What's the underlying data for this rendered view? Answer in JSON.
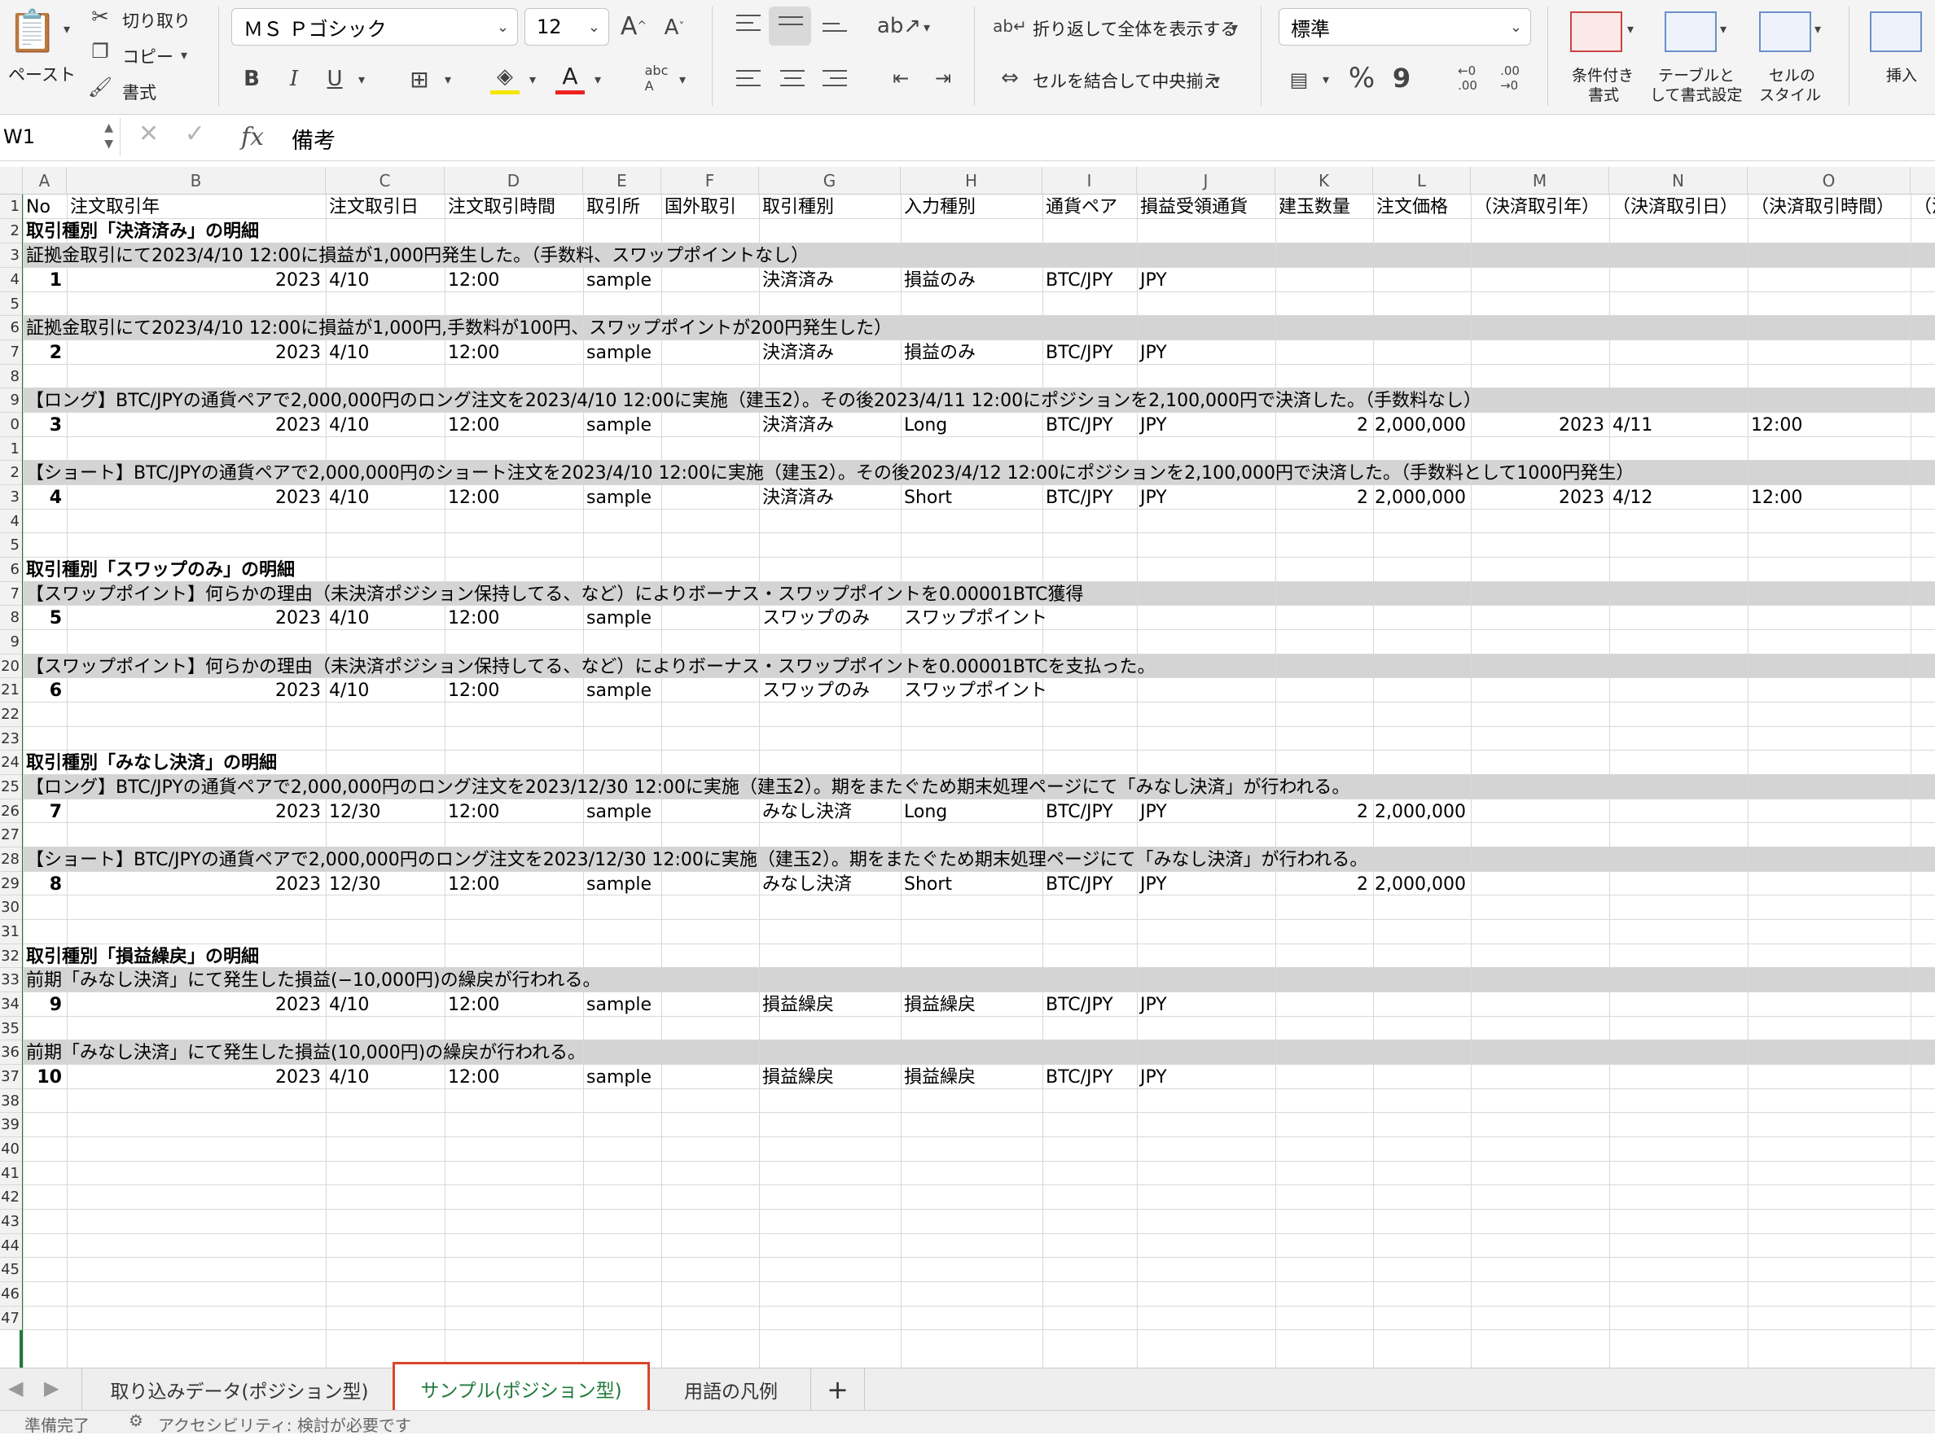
{
  "ribbon": {
    "paste_label": "ペースト",
    "cut_label": "切り取り",
    "copy_label": "コピー",
    "format_painter_label": "書式",
    "font_name": "ＭＳ Ｐゴシック",
    "font_size": "12",
    "bold": "B",
    "italic": "I",
    "underline": "U",
    "wrap_text_label": "折り返して全体を表示する",
    "merge_center_label": "セルを結合して中央揃え",
    "number_format": "標準",
    "percent": "%",
    "comma": "9",
    "conditional_format_label_1": "条件付き",
    "conditional_format_label_2": "書式",
    "table_format_label_1": "テーブルと",
    "table_format_label_2": "して書式設定",
    "cell_style_label_1": "セルの",
    "cell_style_label_2": "スタイル",
    "insert_label": "挿入"
  },
  "formula_bar": {
    "name_box": "W1",
    "fx": "fx",
    "content": "備考"
  },
  "columns": [
    "A",
    "B",
    "C",
    "D",
    "E",
    "F",
    "G",
    "H",
    "I",
    "J",
    "K",
    "L",
    "M",
    "N",
    "O"
  ],
  "header_row": [
    "No",
    "注文取引年",
    "注文取引日",
    "注文取引時間",
    "取引所",
    "国外取引",
    "取引種別",
    "入力種別",
    "通貨ペア",
    "損益受領通貨",
    "建玉数量",
    "注文価格",
    "（決済取引年）",
    "（決済取引日）",
    "（決済取引時間）",
    "（決"
  ],
  "row_numbers": [
    "1",
    "2",
    "3",
    "4",
    "5",
    "6",
    "7",
    "8",
    "9",
    "0",
    "1",
    "2",
    "3",
    "4",
    "5",
    "6",
    "7",
    "8",
    "9",
    "20",
    "21",
    "22",
    "23",
    "24",
    "25",
    "26",
    "27",
    "28",
    "29",
    "30",
    "31",
    "32",
    "33",
    "34",
    "35",
    "36",
    "37",
    "38",
    "39",
    "40",
    "41",
    "42",
    "43",
    "44",
    "45",
    "46",
    "47"
  ],
  "sections": {
    "r2": "取引種別「決済済み」の明細",
    "r3": "証拠金取引にて2023/4/10 12:00に損益が1,000円発生した。（手数料、スワップポイントなし）",
    "r6": "証拠金取引にて2023/4/10 12:00に損益が1,000円,手数料が100円、スワップポイントが200円発生した）",
    "r9": "【ロング】BTC/JPYの通貨ペアで2,000,000円のロング注文を2023/4/10 12:00に実施（建玉2）。その後2023/4/11 12:00にポジションを2,100,000円で決済した。（手数料なし）",
    "r12": "【ショート】BTC/JPYの通貨ペアで2,000,000円のショート注文を2023/4/10 12:00に実施（建玉2）。その後2023/4/12 12:00にポジションを2,100,000円で決済した。（手数料として1000円発生）",
    "r16": "取引種別「スワップのみ」の明細",
    "r17": "【スワップポイント】何らかの理由（未決済ポジション保持してる、など）によりボーナス・スワップポイントを0.00001BTC獲得",
    "r20": "【スワップポイント】何らかの理由（未決済ポジション保持してる、など）によりボーナス・スワップポイントを0.00001BTCを支払った。",
    "r24": "取引種別「みなし決済」の明細",
    "r25": "【ロング】BTC/JPYの通貨ペアで2,000,000円のロング注文を2023/12/30 12:00に実施（建玉2）。期をまたぐため期末処理ページにて「みなし決済」が行われる。",
    "r28": "【ショート】BTC/JPYの通貨ペアで2,000,000円のロング注文を2023/12/30 12:00に実施（建玉2）。期をまたぐため期末処理ページにて「みなし決済」が行われる。",
    "r32": "取引種別「損益繰戻」の明細",
    "r33": "前期「みなし決済」にて発生した損益(−10,000円)の繰戻が行われる。",
    "r36": "前期「みなし決済」にて発生した損益(10,000円)の繰戻が行われる。"
  },
  "records": [
    {
      "no": "1",
      "year": "2023",
      "date": "4/10",
      "time": "12:00",
      "exchange": "sample",
      "type": "決済済み",
      "input": "損益のみ",
      "pair": "BTC/JPY",
      "ccy": "JPY",
      "qty": "",
      "price": "",
      "s_year": "",
      "s_date": "",
      "s_time": ""
    },
    {
      "no": "2",
      "year": "2023",
      "date": "4/10",
      "time": "12:00",
      "exchange": "sample",
      "type": "決済済み",
      "input": "損益のみ",
      "pair": "BTC/JPY",
      "ccy": "JPY",
      "qty": "",
      "price": "",
      "s_year": "",
      "s_date": "",
      "s_time": ""
    },
    {
      "no": "3",
      "year": "2023",
      "date": "4/10",
      "time": "12:00",
      "exchange": "sample",
      "type": "決済済み",
      "input": "Long",
      "pair": "BTC/JPY",
      "ccy": "JPY",
      "qty": "2",
      "price": "2,000,000",
      "s_year": "2023",
      "s_date": "4/11",
      "s_time": "12:00"
    },
    {
      "no": "4",
      "year": "2023",
      "date": "4/10",
      "time": "12:00",
      "exchange": "sample",
      "type": "決済済み",
      "input": "Short",
      "pair": "BTC/JPY",
      "ccy": "JPY",
      "qty": "2",
      "price": "2,000,000",
      "s_year": "2023",
      "s_date": "4/12",
      "s_time": "12:00"
    },
    {
      "no": "5",
      "year": "2023",
      "date": "4/10",
      "time": "12:00",
      "exchange": "sample",
      "type": "スワップのみ",
      "input": "スワップポイント",
      "pair": "",
      "ccy": "",
      "qty": "",
      "price": "",
      "s_year": "",
      "s_date": "",
      "s_time": ""
    },
    {
      "no": "6",
      "year": "2023",
      "date": "4/10",
      "time": "12:00",
      "exchange": "sample",
      "type": "スワップのみ",
      "input": "スワップポイント",
      "pair": "",
      "ccy": "",
      "qty": "",
      "price": "",
      "s_year": "",
      "s_date": "",
      "s_time": ""
    },
    {
      "no": "7",
      "year": "2023",
      "date": "12/30",
      "time": "12:00",
      "exchange": "sample",
      "type": "みなし決済",
      "input": "Long",
      "pair": "BTC/JPY",
      "ccy": "JPY",
      "qty": "2",
      "price": "2,000,000",
      "s_year": "",
      "s_date": "",
      "s_time": ""
    },
    {
      "no": "8",
      "year": "2023",
      "date": "12/30",
      "time": "12:00",
      "exchange": "sample",
      "type": "みなし決済",
      "input": "Short",
      "pair": "BTC/JPY",
      "ccy": "JPY",
      "qty": "2",
      "price": "2,000,000",
      "s_year": "",
      "s_date": "",
      "s_time": ""
    },
    {
      "no": "9",
      "year": "2023",
      "date": "4/10",
      "time": "12:00",
      "exchange": "sample",
      "type": "損益繰戻",
      "input": "損益繰戻",
      "pair": "BTC/JPY",
      "ccy": "JPY",
      "qty": "",
      "price": "",
      "s_year": "",
      "s_date": "",
      "s_time": ""
    },
    {
      "no": "10",
      "year": "2023",
      "date": "4/10",
      "time": "12:00",
      "exchange": "sample",
      "type": "損益繰戻",
      "input": "損益繰戻",
      "pair": "BTC/JPY",
      "ccy": "JPY",
      "qty": "",
      "price": "",
      "s_year": "",
      "s_date": "",
      "s_time": ""
    }
  ],
  "sheet_tabs": {
    "tab1": "取り込みデータ(ポジション型)",
    "tab2": "サンプル(ポジション型)",
    "tab3": "用語の凡例",
    "add": "+"
  },
  "status": {
    "ready": "準備完了",
    "accessibility": "アクセシビリティ: 検討が必要です"
  },
  "colors": {
    "accent_green": "#1e7a3c",
    "highlight_red": "#d9452c",
    "section_gray": "#d4d4d4"
  }
}
